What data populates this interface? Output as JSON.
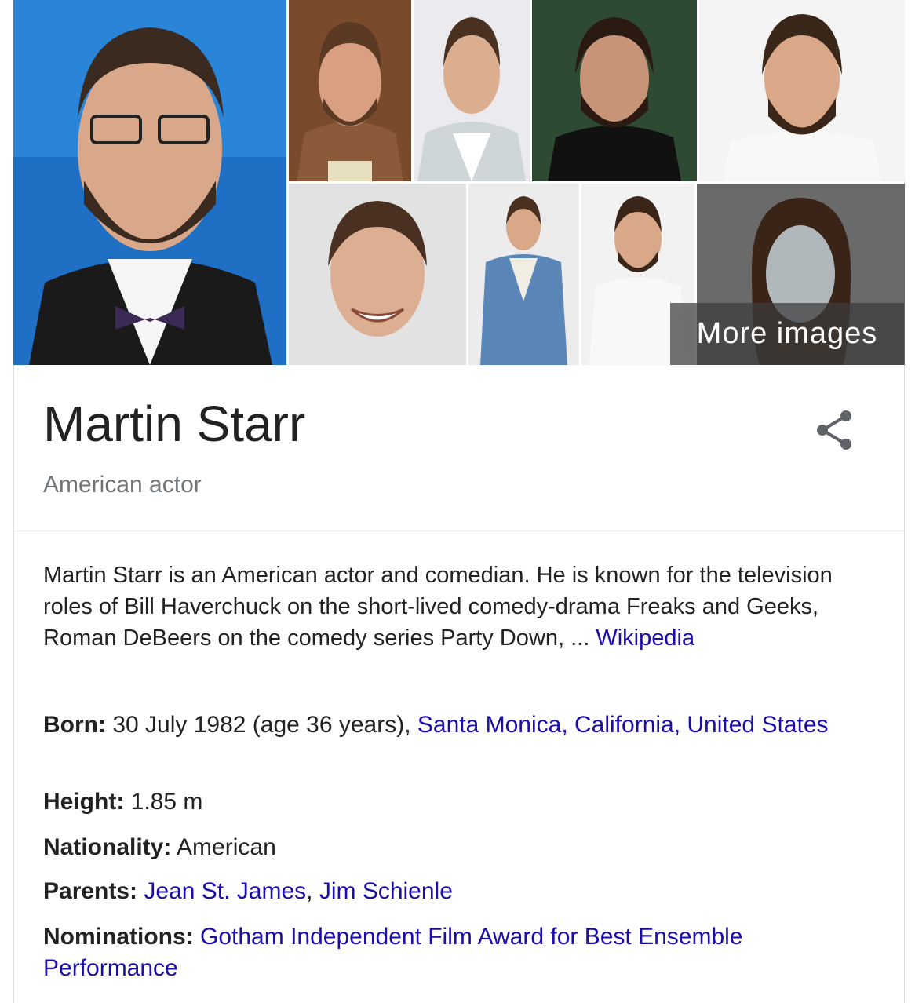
{
  "images": {
    "more_label": "More images"
  },
  "entity": {
    "name": "Martin Starr",
    "subtitle": "American actor"
  },
  "description": {
    "text": "Martin Starr is an American actor and comedian. He is known for the television roles of Bill Haverchuck on the short-lived comedy-drama Freaks and Geeks, Roman DeBeers on the comedy series Party Down, ... ",
    "source_link": "Wikipedia"
  },
  "facts": {
    "born": {
      "label": "Born:",
      "value": " 30 July 1982 (age 36 years), ",
      "link": "Santa Monica, California, United States"
    },
    "height": {
      "label": "Height:",
      "value": " 1.85 m"
    },
    "nationality": {
      "label": "Nationality:",
      "value": " American"
    },
    "parents": {
      "label": "Parents:",
      "link1": "Jean St. James",
      "sep": ", ",
      "link2": "Jim Schienle"
    },
    "nominations": {
      "label": "Nominations:",
      "link": "Gotham Independent Film Award for Best Ensemble Performance"
    }
  },
  "colors": {
    "link": "#1a0dab",
    "title": "#222222",
    "subtitle": "#70757a"
  },
  "icons": {
    "share": "share-icon"
  }
}
